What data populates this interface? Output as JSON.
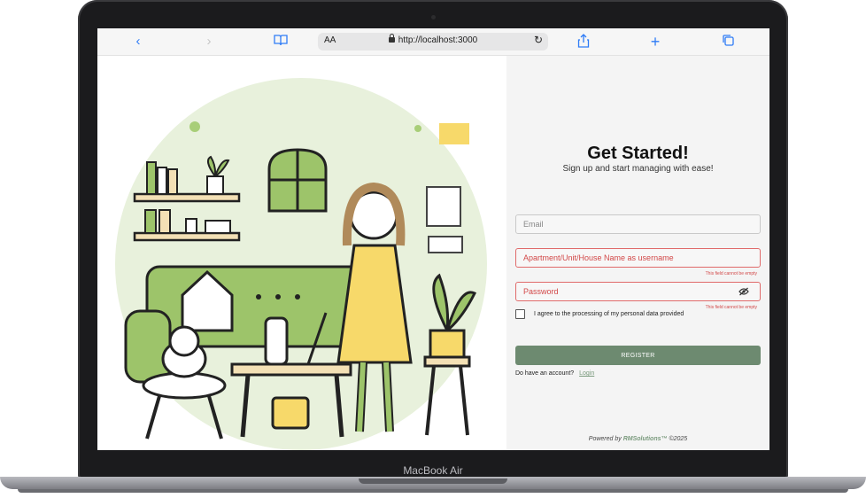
{
  "device": {
    "model_label": "MacBook Air"
  },
  "browser": {
    "text_size_label": "AA",
    "url": "http://localhost:3000",
    "icons": [
      "back-icon",
      "forward-icon",
      "book-icon",
      "lock-icon",
      "reload-icon",
      "share-icon",
      "plus-icon",
      "tabs-icon"
    ]
  },
  "form": {
    "title": "Get Started!",
    "subtitle": "Sign up and start managing with ease!",
    "email_placeholder": "Email",
    "username_placeholder": "Apartment/Unit/House Name as username",
    "username_error": "This field cannot be empty",
    "password_placeholder": "Password",
    "password_error": "This field cannot be empty",
    "consent_label": "I agree to the processing of my personal data provided",
    "register_label": "REGISTER",
    "have_account_text": "Do have an account?",
    "login_link": "Login",
    "footer_prefix": "Powered by",
    "footer_brand": "RMSolutions™",
    "footer_suffix": "©2025"
  },
  "colors": {
    "accent_green": "#6d8a70",
    "error_red": "#d24848",
    "illustration_green": "#9dc46a",
    "illustration_yellow": "#f7d96a"
  }
}
